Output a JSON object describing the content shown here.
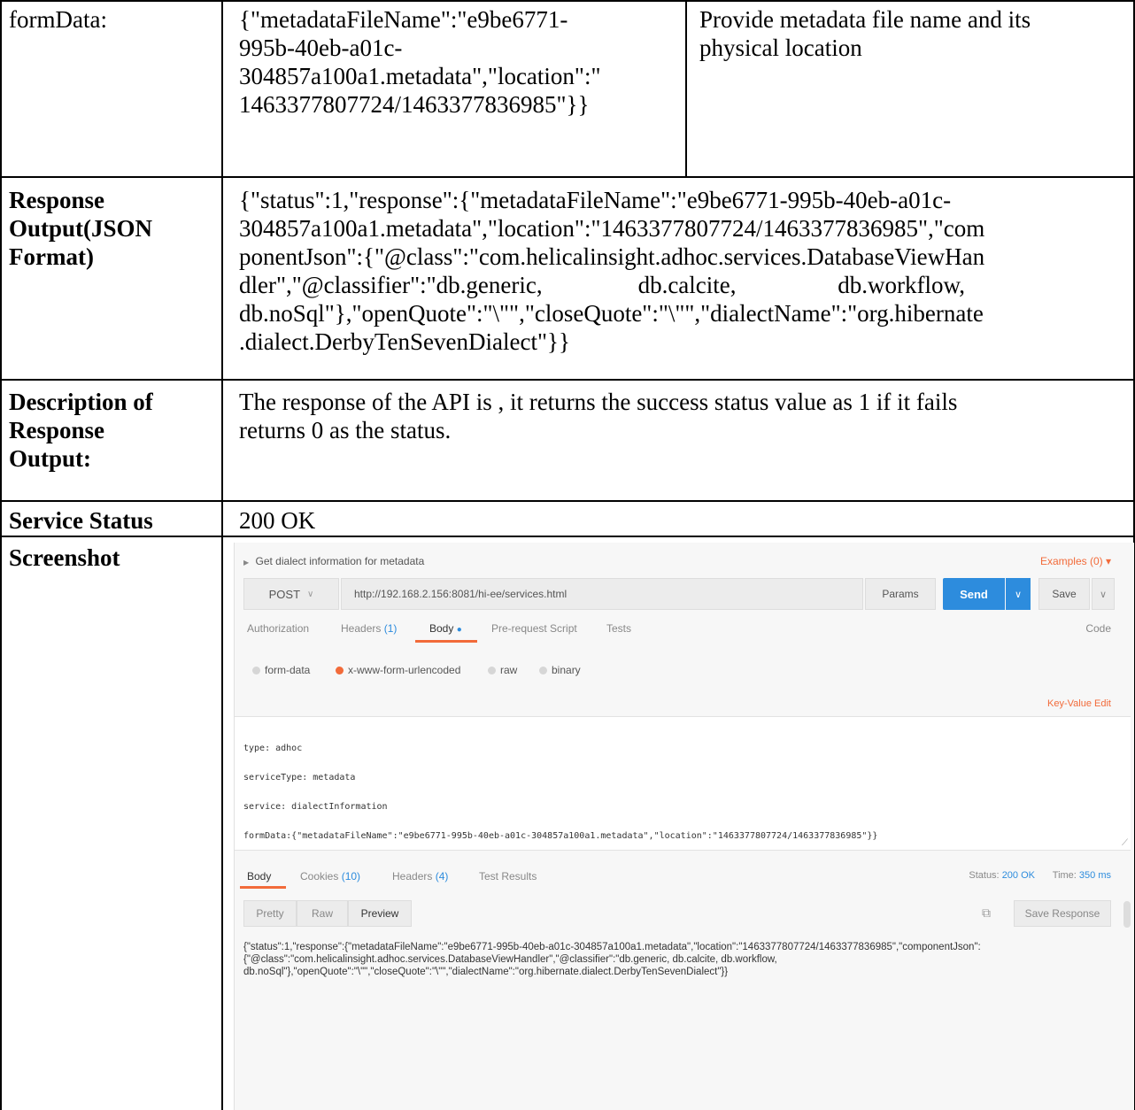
{
  "table": {
    "rows": [
      {
        "label": "formData:",
        "value_lines": [
          "{\"metadataFileName\":\"e9be6771-",
          "995b-40eb-a01c-",
          "304857a100a1.metadata\",\"location\":\"",
          "1463377807724/1463377836985\"}}"
        ],
        "description_lines": [
          "Provide metadata file name and its",
          "physical  location"
        ]
      },
      {
        "label_lines": [
          "Response",
          "Output(JSON",
          "Format)"
        ],
        "value_lines": [
          "{\"status\":1,\"response\":{\"metadataFileName\":\"e9be6771-995b-40eb-a01c-",
          "304857a100a1.metadata\",\"location\":\"1463377807724/1463377836985\",\"com",
          "ponentJson\":{\"@class\":\"com.helicalinsight.adhoc.services.DatabaseViewHan",
          "dler\",\"@classifier\":\"db.generic,                db.calcite,                 db.workflow,",
          "db.noSql\"},\"openQuote\":\"\\\"\",\"closeQuote\":\"\\\"\",\"dialectName\":\"org.hibernate",
          ".dialect.DerbyTenSevenDialect\"}}"
        ]
      },
      {
        "label_lines": [
          "Description of",
          "Response",
          "Output:"
        ],
        "value_lines": [
          "The response of the API is , it returns the success status value as 1 if it fails",
          "returns 0 as the status."
        ]
      },
      {
        "label": "Service Status",
        "value": "200 OK"
      },
      {
        "label": "Screenshot"
      }
    ]
  },
  "postman": {
    "request_name": "Get dialect information for metadata",
    "examples": "Examples (0) ▾",
    "method": "POST",
    "url": "http://192.168.2.156:8081/hi-ee/services.html",
    "params": "Params",
    "send": "Send",
    "save": "Save",
    "tabs": {
      "authorization": "Authorization",
      "headers": "Headers",
      "headers_count": "(1)",
      "body": "Body",
      "prerequest": "Pre-request Script",
      "tests": "Tests",
      "code": "Code"
    },
    "body_types": [
      "form-data",
      "x-www-form-urlencoded",
      "raw",
      "binary"
    ],
    "selected_body_type": "x-www-form-urlencoded",
    "kv_edit": "Key-Value Edit",
    "editor_lines": [
      "type: adhoc",
      "serviceType: metadata",
      "service: dialectInformation",
      "formData:{\"metadataFileName\":\"e9be6771-995b-40eb-a01c-304857a100a1.metadata\",\"location\":\"1463377807724/1463377836985\"}}"
    ],
    "resp_tabs": {
      "body": "Body",
      "cookies": "Cookies",
      "cookies_count": "(10)",
      "headers": "Headers",
      "headers_count": "(4)",
      "test_results": "Test Results"
    },
    "status_label": "Status:",
    "status_value": "200 OK",
    "time_label": "Time:",
    "time_value": "350 ms",
    "view_modes": [
      "Pretty",
      "Raw",
      "Preview"
    ],
    "selected_view": "Preview",
    "save_response": "Save Response",
    "response_lines": [
      "{\"status\":1,\"response\":{\"metadataFileName\":\"e9be6771-995b-40eb-a01c-304857a100a1.metadata\",\"location\":\"1463377807724/1463377836985\",\"componentJson\":",
      "{\"@class\":\"com.helicalinsight.adhoc.services.DatabaseViewHandler\",\"@classifier\":\"db.generic, db.calcite, db.workflow,",
      "db.noSql\"},\"openQuote\":\"\\\"\",\"closeQuote\":\"\\\"\",\"dialectName\":\"org.hibernate.dialect.DerbyTenSevenDialect\"}}"
    ],
    "accent_color": "#f26b3a",
    "send_color": "#2d8cdd"
  }
}
